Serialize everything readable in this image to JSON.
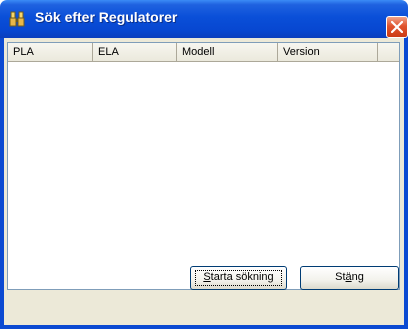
{
  "window": {
    "title": "Sök efter Regulatorer"
  },
  "list": {
    "columns": [
      "PLA",
      "ELA",
      "Modell",
      "Version"
    ],
    "rows": []
  },
  "buttons": {
    "start": {
      "mnemonic": "S",
      "rest": "tarta sökning"
    },
    "close": {
      "before": "St",
      "mnemonic": "ä",
      "after": "ng"
    }
  },
  "colors": {
    "titlebar": "#0a4fd8",
    "close_button": "#e0542e",
    "dialog_face": "#ece9d8"
  }
}
